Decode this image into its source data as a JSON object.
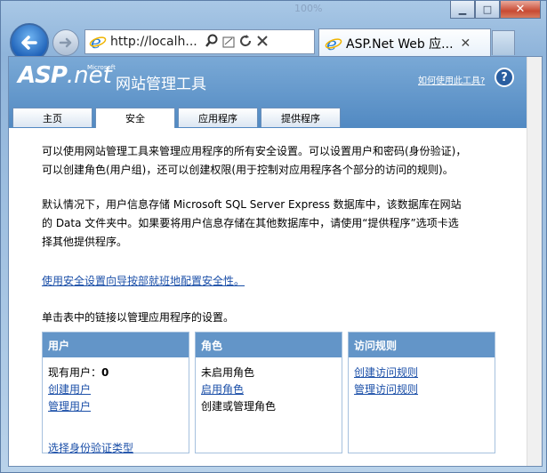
{
  "browser": {
    "faded_text": "100%",
    "address": "http://localh...",
    "tab_title": "ASP.Net Web 应...",
    "minimize_glyph": "▁",
    "maximize_glyph": "□",
    "close_glyph": "✕"
  },
  "header": {
    "logo_asp": "ASP",
    "logo_net": ".net",
    "logo_microsoft": "Microsoft",
    "title": "网站管理工具",
    "help_link": "如何使用此工具?",
    "help_icon_text": "?"
  },
  "tabs": [
    {
      "label": "主页"
    },
    {
      "label": "安全"
    },
    {
      "label": "应用程序"
    },
    {
      "label": "提供程序"
    }
  ],
  "content": {
    "para1_line1": "可以使用网站管理工具来管理应用程序的所有安全设置。可以设置用户和密码(身份验证)，",
    "para1_line2": "可以创建角色(用户组)，还可以创建权限(用于控制对应用程序各个部分的访问的规则)。",
    "para2_line1": "默认情况下，用户信息存储 Microsoft SQL Server Express 数据库中，该数据库在网站",
    "para2_line2": "的 Data 文件夹中。如果要将用户信息存储在其他数据库中，请使用“提供程序”选项卡选",
    "para2_line3": "择其他提供程序。",
    "wizard_link": "使用安全设置向导按部就班地配置安全性。",
    "intro": "单击表中的链接以管理应用程序的设置。"
  },
  "users_col": {
    "heading": "用户",
    "existing_label": "现有用户：",
    "existing_count": "0",
    "create": "创建用户",
    "manage": "管理用户",
    "auth_type": "选择身份验证类型"
  },
  "roles_col": {
    "heading": "角色",
    "status": "未启用角色",
    "enable": "启用角色",
    "create_manage": "创建或管理角色"
  },
  "access_col": {
    "heading": "访问规则",
    "create": "创建访问规则",
    "manage": "管理访问规则"
  }
}
